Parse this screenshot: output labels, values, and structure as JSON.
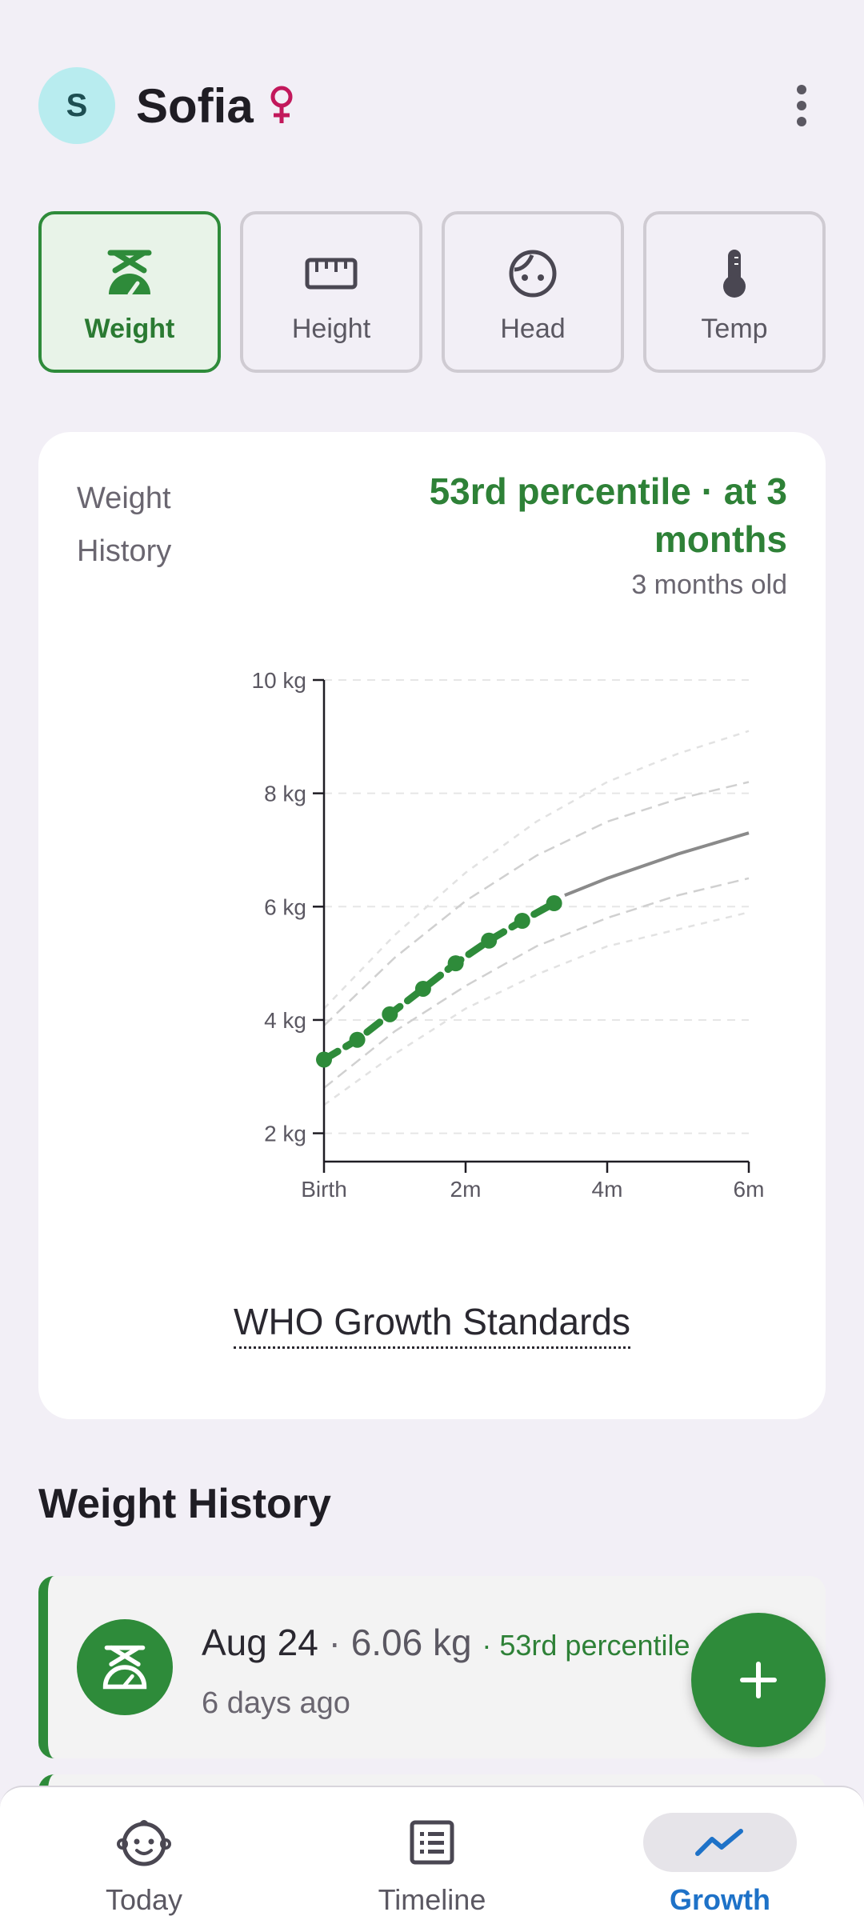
{
  "header": {
    "avatar_initial": "S",
    "child_name": "Sofia",
    "gender_symbol": "♀",
    "gender_color": "#c2185b"
  },
  "metrics": [
    {
      "label": "Weight",
      "icon": "scale-icon",
      "selected": true
    },
    {
      "label": "Height",
      "icon": "ruler-icon",
      "selected": false
    },
    {
      "label": "Head",
      "icon": "face-icon",
      "selected": false
    },
    {
      "label": "Temp",
      "icon": "thermometer-icon",
      "selected": false
    }
  ],
  "card": {
    "title": "Weight History",
    "percentile_text": "53rd percentile · at 3 months",
    "age_text": "3 months old",
    "who_link": "WHO Growth Standards"
  },
  "chart_data": {
    "type": "line",
    "x_unit": "months",
    "xlim": [
      0,
      6
    ],
    "ylim": [
      1.5,
      10
    ],
    "x_ticks": [
      {
        "value": 0,
        "label": "Birth"
      },
      {
        "value": 2,
        "label": "2m"
      },
      {
        "value": 4,
        "label": "4m"
      },
      {
        "value": 6,
        "label": "6m"
      }
    ],
    "y_ticks": [
      {
        "value": 2,
        "label": "2 kg"
      },
      {
        "value": 4,
        "label": "4 kg"
      },
      {
        "value": 6,
        "label": "6 kg"
      },
      {
        "value": 8,
        "label": "8 kg"
      },
      {
        "value": 10,
        "label": "10 kg"
      }
    ],
    "grid": true,
    "series": [
      {
        "style": "measured",
        "color": "#2e8b3a",
        "points": [
          [
            0,
            3.3
          ],
          [
            0.47,
            3.65
          ],
          [
            0.93,
            4.1
          ],
          [
            1.4,
            4.55
          ],
          [
            1.86,
            5.0
          ],
          [
            2.33,
            5.4
          ],
          [
            2.8,
            5.75
          ],
          [
            3.25,
            6.06
          ]
        ]
      },
      {
        "style": "projection",
        "color": "#8a8a8a",
        "points": [
          [
            3.4,
            6.2
          ],
          [
            4,
            6.5
          ],
          [
            5,
            6.93
          ],
          [
            6,
            7.3
          ]
        ]
      },
      {
        "style": "percentile-outer",
        "color": "#e2e2e2",
        "points": [
          [
            0,
            4.2
          ],
          [
            1,
            5.5
          ],
          [
            2,
            6.6
          ],
          [
            3,
            7.5
          ],
          [
            4,
            8.2
          ],
          [
            5,
            8.7
          ],
          [
            6,
            9.1
          ]
        ]
      },
      {
        "style": "percentile-inner",
        "color": "#d0d0d0",
        "points": [
          [
            0,
            3.9
          ],
          [
            1,
            5.1
          ],
          [
            2,
            6.1
          ],
          [
            3,
            6.9
          ],
          [
            4,
            7.5
          ],
          [
            5,
            7.9
          ],
          [
            6,
            8.2
          ]
        ]
      },
      {
        "style": "percentile-inner",
        "color": "#d0d0d0",
        "points": [
          [
            0,
            2.8
          ],
          [
            1,
            3.8
          ],
          [
            2,
            4.6
          ],
          [
            3,
            5.3
          ],
          [
            4,
            5.8
          ],
          [
            5,
            6.2
          ],
          [
            6,
            6.5
          ]
        ]
      },
      {
        "style": "percentile-outer",
        "color": "#e2e2e2",
        "points": [
          [
            0,
            2.5
          ],
          [
            1,
            3.4
          ],
          [
            2,
            4.2
          ],
          [
            3,
            4.8
          ],
          [
            4,
            5.3
          ],
          [
            5,
            5.6
          ],
          [
            6,
            5.9
          ]
        ]
      }
    ]
  },
  "history": {
    "title": "Weight History",
    "entries": [
      {
        "date": "Aug 24",
        "value": "6.06 kg",
        "percentile": "53rd percentile",
        "relative": "6 days ago",
        "icon": "scale-icon"
      }
    ]
  },
  "fab": {
    "icon": "plus-icon"
  },
  "nav": [
    {
      "label": "Today",
      "icon": "baby-face-icon",
      "active": false
    },
    {
      "label": "Timeline",
      "icon": "list-icon",
      "active": false
    },
    {
      "label": "Growth",
      "icon": "trend-icon",
      "active": true
    }
  ]
}
